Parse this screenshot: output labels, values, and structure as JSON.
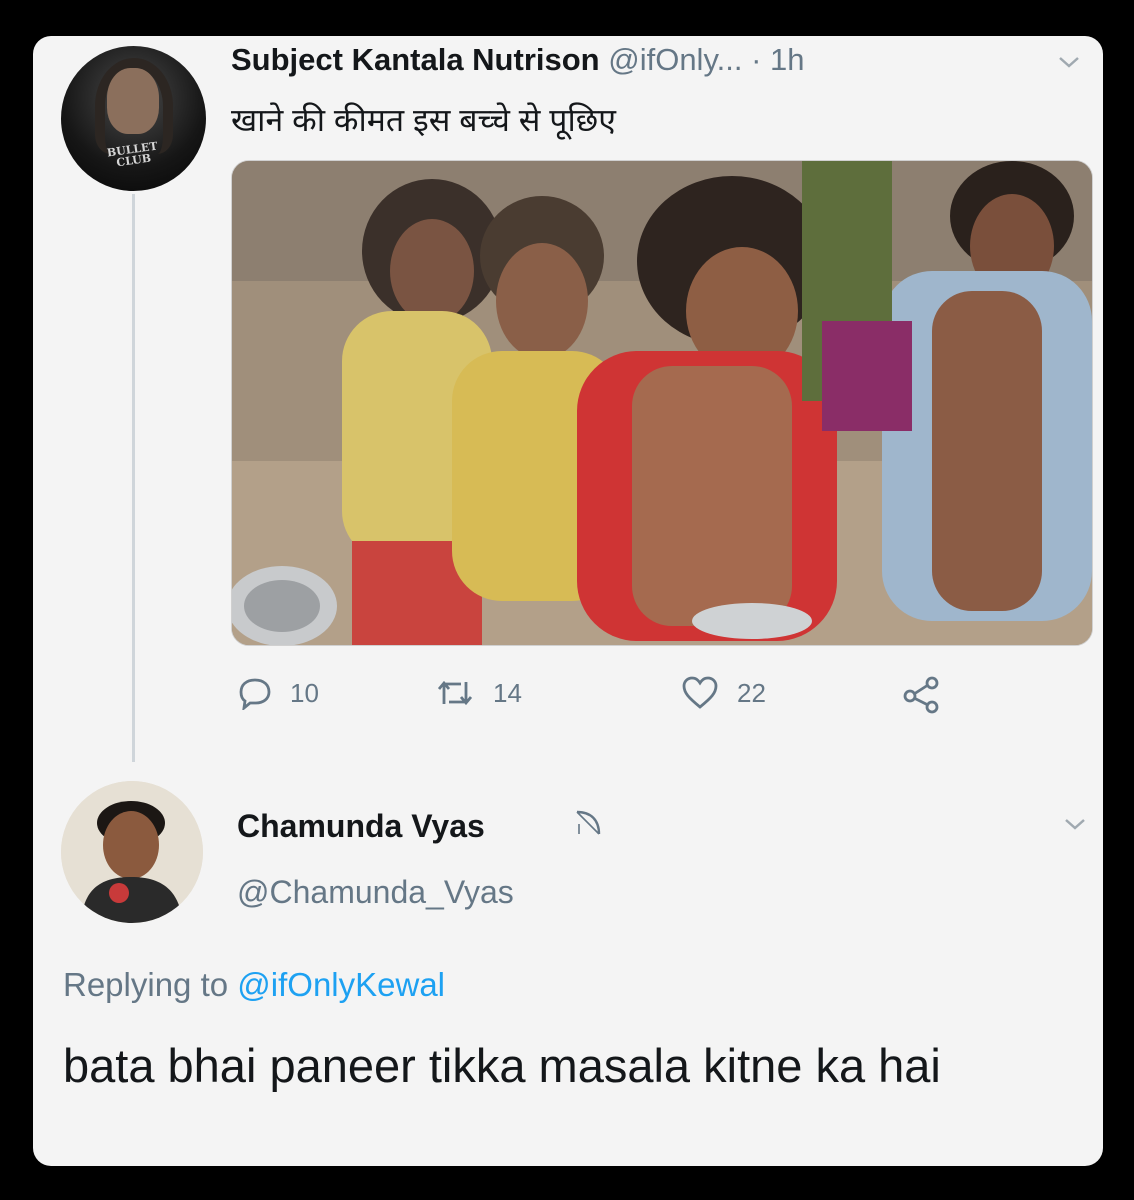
{
  "tweet": {
    "author_name": "Subject Kantala Nutrison",
    "handle": "@ifOnly...",
    "time": "· 1h",
    "text": "खाने की कीमत इस बच्चे से पूछिए",
    "avatar_badge": "BULLET CLUB",
    "photo_icon": "photo-of-children",
    "actions": {
      "reply_count": "10",
      "retweet_count": "14",
      "like_count": "22"
    }
  },
  "reply": {
    "author_name": "Chamunda Vyas",
    "handle": "@Chamunda_Vyas",
    "replying_prefix": "Replying to",
    "replying_to": "@ifOnlyKewal",
    "text": "bata bhai paneer tikka masala kitne ka hai"
  },
  "icons": {
    "reply": "reply-icon",
    "retweet": "retweet-icon",
    "like": "heart-icon",
    "share": "share-icon",
    "more": "chevron-down-icon"
  },
  "colors": {
    "background": "#000000",
    "card": "#f4f4f4",
    "text": "#14171a",
    "muted": "#657786",
    "link": "#1da1f2"
  }
}
